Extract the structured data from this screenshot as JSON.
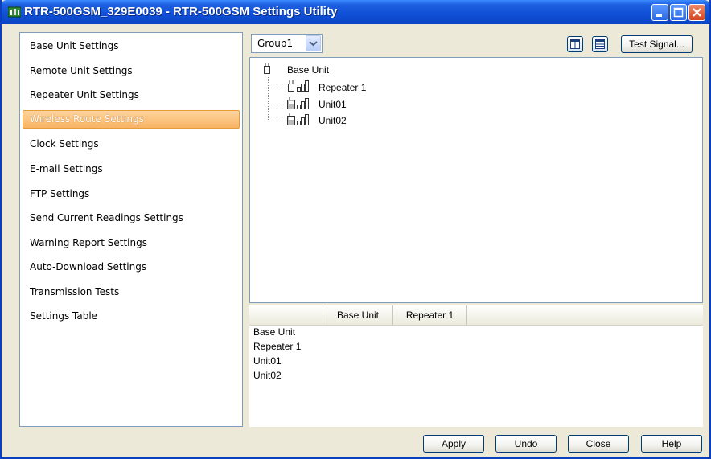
{
  "window": {
    "title": "RTR-500GSM_329E0039 - RTR-500GSM Settings Utility"
  },
  "sidebar": {
    "items": [
      {
        "label": "Base Unit Settings"
      },
      {
        "label": "Remote Unit Settings"
      },
      {
        "label": "Repeater Unit Settings"
      },
      {
        "label": "Wireless Route Settings",
        "selected": true
      },
      {
        "label": "Clock Settings"
      },
      {
        "label": "E-mail Settings"
      },
      {
        "label": "FTP Settings"
      },
      {
        "label": "Send Current Readings Settings"
      },
      {
        "label": "Warning Report Settings"
      },
      {
        "label": "Auto-Download Settings"
      },
      {
        "label": "Transmission  Tests"
      },
      {
        "label": "Settings Table"
      }
    ]
  },
  "toolbar": {
    "group_value": "Group1",
    "test_signal_label": "Test Signal..."
  },
  "tree": {
    "root": "Base Unit",
    "children": [
      "Repeater 1",
      "Unit01",
      "Unit02"
    ]
  },
  "table": {
    "columns": [
      "",
      "Base Unit",
      "Repeater 1"
    ],
    "rows": [
      "Base Unit",
      "Repeater 1",
      "Unit01",
      "Unit02"
    ]
  },
  "buttons": {
    "apply": "Apply",
    "undo": "Undo",
    "close": "Close",
    "help": "Help"
  },
  "colors": {
    "title_bar": "#0f4fd6",
    "selected_item": "#f8b464",
    "window_bg": "#ece9d8"
  }
}
